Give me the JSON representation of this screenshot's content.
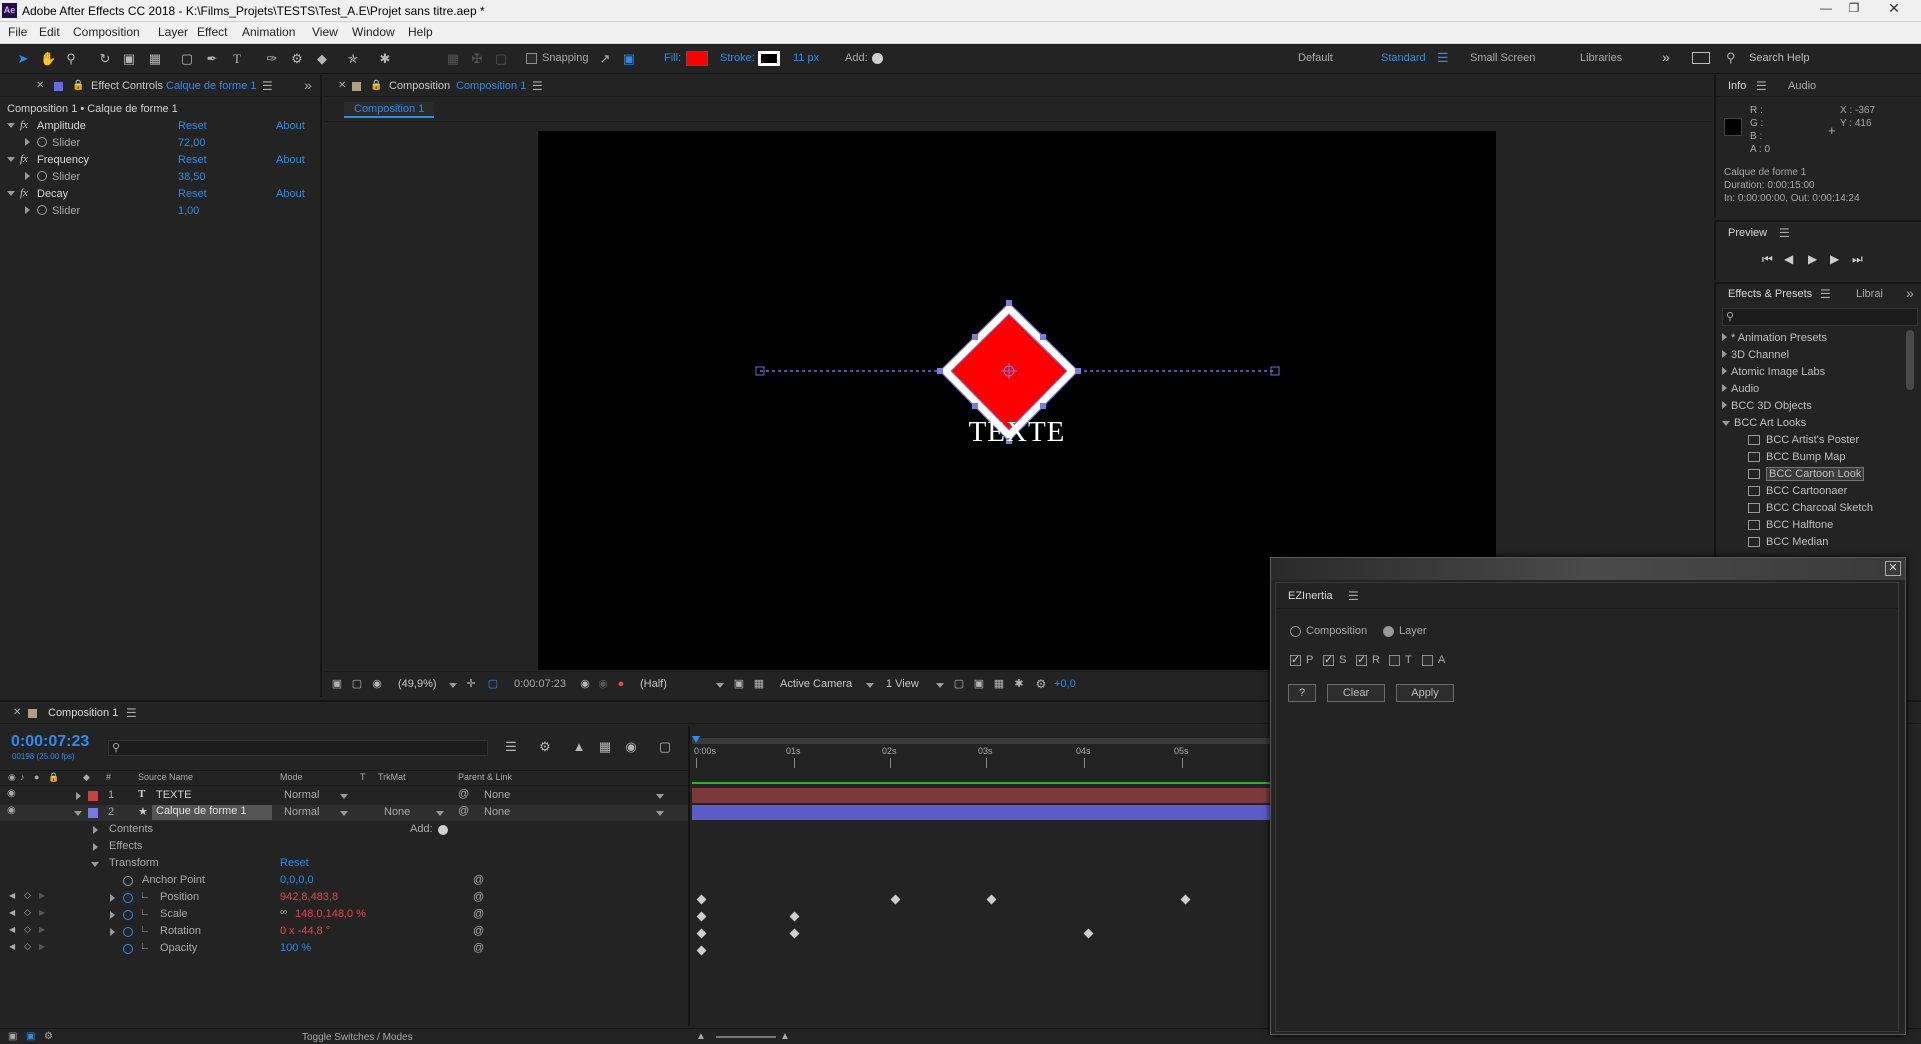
{
  "window": {
    "app_icon": "Ae",
    "title": "Adobe After Effects CC 2018 - K:\\Films_Projets\\TESTS\\Test_A.E\\Projet sans titre.aep *"
  },
  "menu": [
    "File",
    "Edit",
    "Composition",
    "Layer",
    "Effect",
    "Animation",
    "View",
    "Window",
    "Help"
  ],
  "toolbar": {
    "snapping_label": "Snapping",
    "fill_label": "Fill:",
    "fill_color": "#ff0000",
    "stroke_label": "Stroke:",
    "stroke_width": "11 px",
    "add_label": "Add:",
    "workspaces": [
      "Default",
      "Standard",
      "Small Screen",
      "Libraries"
    ],
    "active_workspace": "Standard",
    "search_help": "Search Help"
  },
  "effect_controls": {
    "tab_label": "Effect Controls",
    "tab_layer": "Calque de forme 1",
    "breadcrumb": "Composition 1 • Calque de forme 1",
    "effects": [
      {
        "name": "Amplitude",
        "reset": "Reset",
        "about": "About",
        "param": "Slider",
        "value": "72,00"
      },
      {
        "name": "Frequency",
        "reset": "Reset",
        "about": "About",
        "param": "Slider",
        "value": "38,50"
      },
      {
        "name": "Decay",
        "reset": "Reset",
        "about": "About",
        "param": "Slider",
        "value": "1,00"
      }
    ]
  },
  "composition_panel": {
    "tab_label": "Composition",
    "tab_comp": "Composition 1",
    "subtab": "Composition 1",
    "canvas_text": "TEXTE",
    "shape_color": "#ff0000",
    "zoom": "(49,9%)",
    "timecode": "0:00:07:23",
    "resolution": "(Half)",
    "camera": "Active Camera",
    "views": "1 View",
    "exposure": "+0,0"
  },
  "info_panel": {
    "tab_info": "Info",
    "tab_audio": "Audio",
    "r": "R :",
    "g": "G :",
    "b": "B :",
    "a": "A :  0",
    "x": "X : -367",
    "y": "Y : 416",
    "layer_name": "Calque de forme 1",
    "duration": "Duration: 0:00:15:00",
    "inout": "In: 0:00:00:00, Out: 0:00:14:24"
  },
  "preview_panel": {
    "label": "Preview"
  },
  "effects_presets": {
    "tab_label": "Effects & Presets",
    "tab_libraries": "Librai",
    "search_placeholder": "",
    "folders": [
      "* Animation Presets",
      "3D Channel",
      "Atomic Image Labs",
      "Audio",
      "BCC 3D Objects",
      "BCC Art Looks"
    ],
    "bcc_items": [
      "BCC Artist's Poster",
      "BCC Bump Map",
      "BCC Cartoon Look",
      "BCC Cartoonaer",
      "BCC Charcoal Sketch",
      "BCC Halftone",
      "BCC Median"
    ],
    "selected_item": "BCC Cartoon Look"
  },
  "timeline": {
    "tab_label": "Composition 1",
    "current_time": "0:00:07:23",
    "frame_info": "00198 (25.00 fps)",
    "columns": {
      "source_name": "Source Name",
      "mode": "Mode",
      "t": "T",
      "trkmat": "TrkMat",
      "parent": "Parent & Link"
    },
    "layers": [
      {
        "num": "1",
        "name": "TEXTE",
        "mode": "Normal",
        "trkmat": "",
        "parent": "None",
        "color": "#c84040"
      },
      {
        "num": "2",
        "name": "Calque de forme 1",
        "mode": "Normal",
        "trkmat": "None",
        "parent": "None",
        "color": "#7a7ae6"
      }
    ],
    "contents_label": "Contents",
    "add_label": "Add:",
    "effects_label": "Effects",
    "transform_label": "Transform",
    "transform_reset": "Reset",
    "properties": [
      {
        "name": "Anchor Point",
        "value": "0,0,0,0",
        "animated": false
      },
      {
        "name": "Position",
        "value": "942,8,483,8",
        "animated": true
      },
      {
        "name": "Scale",
        "value": "148,0,148,0 %",
        "animated": true
      },
      {
        "name": "Rotation",
        "value": "0 x -44,8 °",
        "animated": true
      },
      {
        "name": "Opacity",
        "value": "100 %",
        "animated": false
      }
    ],
    "ruler": [
      "0:00s",
      "01s",
      "02s",
      "03s",
      "04s",
      "05s"
    ],
    "footer_toggle": "Toggle Switches / Modes"
  },
  "ezinertia": {
    "title": "EZInertia",
    "composition_label": "Composition",
    "layer_label": "Layer",
    "checks": [
      {
        "label": "P",
        "checked": true
      },
      {
        "label": "S",
        "checked": true
      },
      {
        "label": "R",
        "checked": true
      },
      {
        "label": "T",
        "checked": false
      },
      {
        "label": "A",
        "checked": false
      }
    ],
    "help_label": "?",
    "clear_label": "Clear",
    "apply_label": "Apply"
  }
}
